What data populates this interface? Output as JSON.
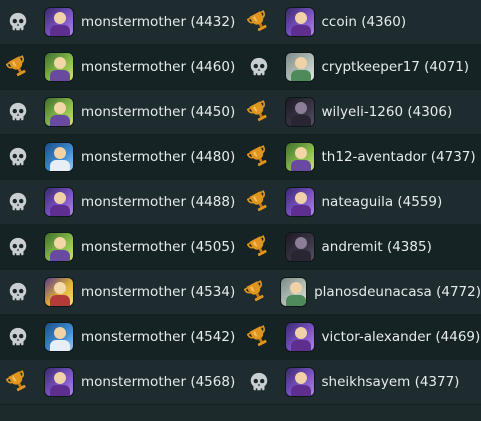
{
  "colors": {
    "skull": "#c9ced0",
    "trophy": "#e0951e",
    "row_odd": "#1e2c2f",
    "row_even": "#162224"
  },
  "rows": [
    {
      "left": {
        "status": "skull-icon",
        "name": "monstermother (4432)",
        "avatar": "purple"
      },
      "right": {
        "status": "trophy-icon",
        "name": "ccoin (4360)",
        "avatar": "purple"
      }
    },
    {
      "left": {
        "status": "trophy-icon",
        "name": "monstermother (4460)",
        "avatar": "green"
      },
      "right": {
        "status": "skull-icon",
        "name": "cryptkeeper17 (4071)",
        "avatar": "gray"
      }
    },
    {
      "left": {
        "status": "skull-icon",
        "name": "monstermother (4450)",
        "avatar": "green"
      },
      "right": {
        "status": "trophy-icon",
        "name": "wilyeli-1260 (4306)",
        "avatar": "dark"
      }
    },
    {
      "left": {
        "status": "skull-icon",
        "name": "monstermother (4480)",
        "avatar": "blue"
      },
      "right": {
        "status": "trophy-icon",
        "name": "th12-aventador (4737)",
        "avatar": "green"
      }
    },
    {
      "left": {
        "status": "skull-icon",
        "name": "monstermother (4488)",
        "avatar": "purple"
      },
      "right": {
        "status": "trophy-icon",
        "name": "nateaguila (4559)",
        "avatar": "purple"
      }
    },
    {
      "left": {
        "status": "skull-icon",
        "name": "monstermother (4505)",
        "avatar": "green"
      },
      "right": {
        "status": "trophy-icon",
        "name": "andremit (4385)",
        "avatar": "dark"
      }
    },
    {
      "left": {
        "status": "skull-icon",
        "name": "monstermother (4534)",
        "avatar": "yellow"
      },
      "right": {
        "status": "trophy-icon",
        "name": "planosdeunacasa (4772)",
        "avatar": "gray"
      }
    },
    {
      "left": {
        "status": "skull-icon",
        "name": "monstermother (4542)",
        "avatar": "blue"
      },
      "right": {
        "status": "trophy-icon",
        "name": "victor-alexander (4469)",
        "avatar": "purple"
      }
    },
    {
      "left": {
        "status": "trophy-icon",
        "name": "monstermother (4568)",
        "avatar": "purple"
      },
      "right": {
        "status": "skull-icon",
        "name": "sheikhsayem (4377)",
        "avatar": "purple"
      }
    }
  ]
}
